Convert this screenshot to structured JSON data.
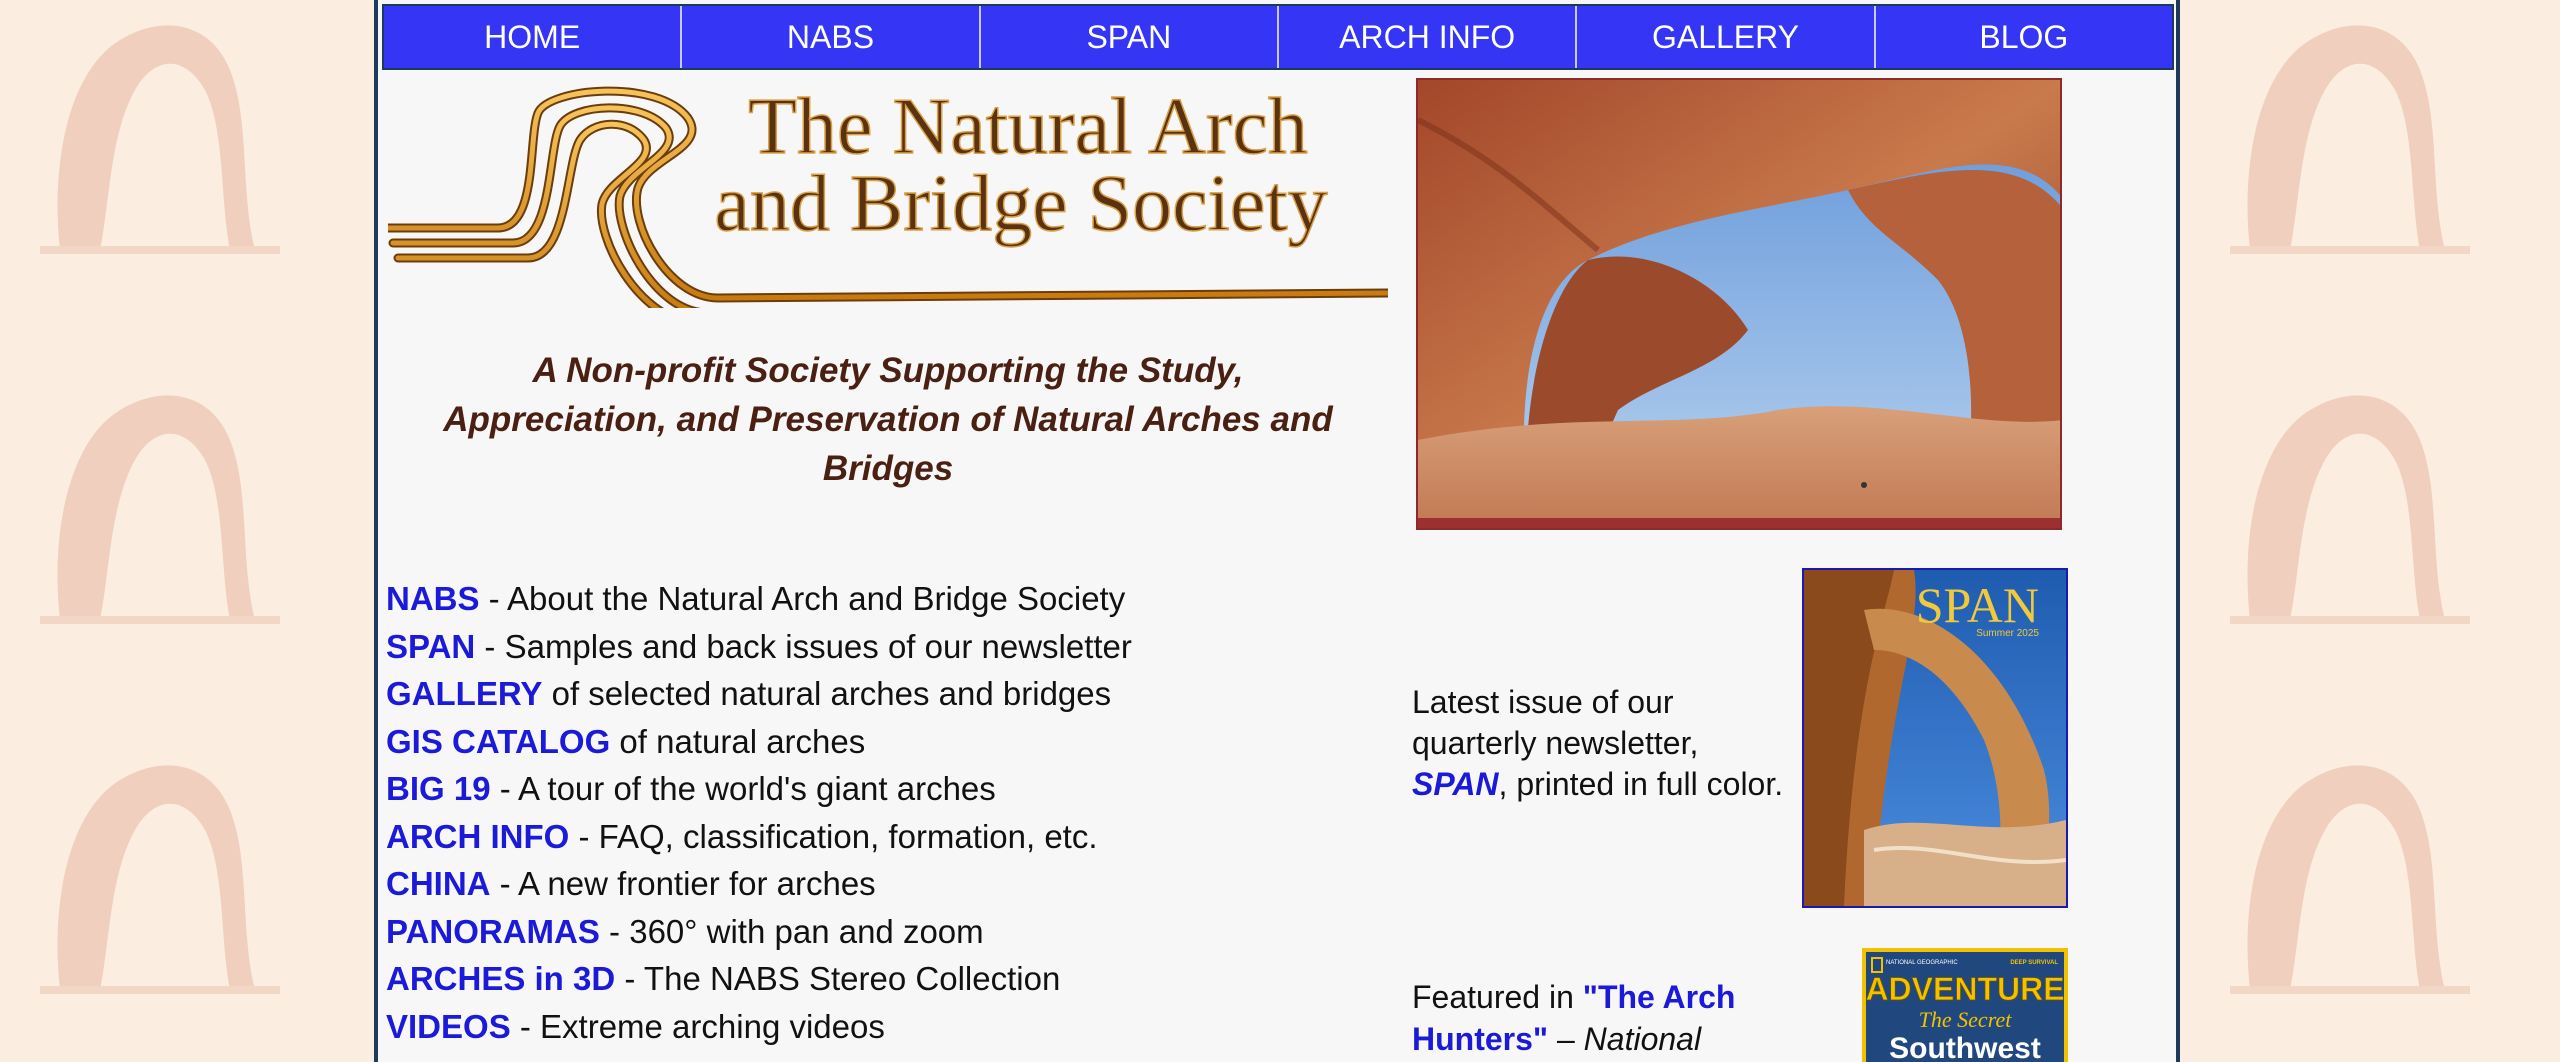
{
  "nav": {
    "items": [
      "HOME",
      "NABS",
      "SPAN",
      "ARCH INFO",
      "GALLERY",
      "BLOG"
    ]
  },
  "logo": {
    "line1": "The Natural Arch",
    "line2": "and Bridge Society"
  },
  "tagline": "A Non-profit Society Supporting the Study, Appreciation, and Preservation of Natural Arches and Bridges",
  "links": [
    {
      "label": "NABS",
      "desc": " - About the Natural Arch and Bridge Society"
    },
    {
      "label": "SPAN",
      "desc": " - Samples and back issues of our newsletter"
    },
    {
      "label": "GALLERY",
      "desc": " of selected natural arches and bridges"
    },
    {
      "label": "GIS CATALOG",
      "desc": " of natural arches"
    },
    {
      "label": "BIG 19",
      "desc": " - A tour of the world's giant arches"
    },
    {
      "label": "ARCH INFO",
      "desc": " - FAQ, classification, formation, etc."
    },
    {
      "label": "CHINA",
      "desc": " - A new frontier for arches"
    },
    {
      "label": "PANORAMAS",
      "desc": " - 360° with pan and zoom"
    },
    {
      "label": "ARCHES in 3D",
      "desc": " - The NABS Stereo Collection"
    },
    {
      "label": "VIDEOS",
      "desc": " - Extreme arching videos"
    }
  ],
  "span_blurb": {
    "text1": "Latest issue of our quarterly newsletter,",
    "name": "SPAN",
    "text2": ", printed in full color."
  },
  "span_cover": {
    "title": "SPAN",
    "issue": "Summer 2025"
  },
  "featured": {
    "prefix": "Featured in ",
    "title": "\"The Arch Hunters\"",
    "dash": " – ",
    "source": "National"
  },
  "ng_cover": {
    "brand": "NATIONAL GEOGRAPHIC",
    "kicker": "DEEP SURVIVAL",
    "title": "ADVENTURE",
    "sub1": "The Secret",
    "sub2": "Southwest"
  },
  "colors": {
    "nav_bg": "#3535f5",
    "link": "#1a1ad8",
    "tagline": "#4a2012",
    "page_bg": "#f7f7f7",
    "body_bg": "#fbeee0"
  }
}
